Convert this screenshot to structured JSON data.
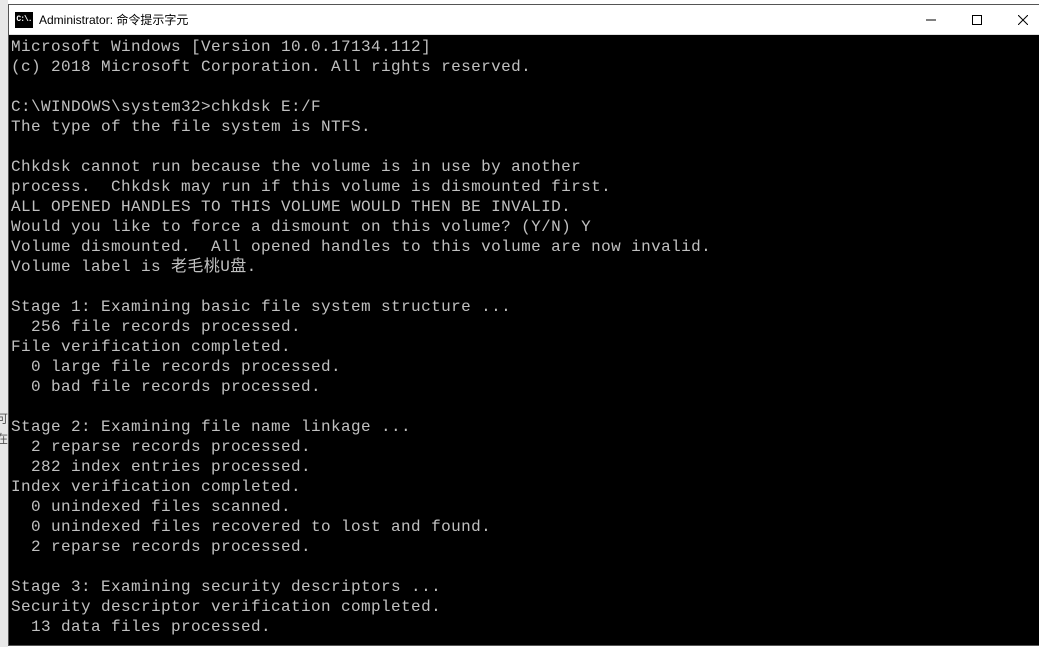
{
  "window": {
    "title": "Administrator: 命令提示字元",
    "icon_label": "C:\\."
  },
  "terminal_lines": [
    "Microsoft Windows [Version 10.0.17134.112]",
    "(c) 2018 Microsoft Corporation. All rights reserved.",
    "",
    "C:\\WINDOWS\\system32>chkdsk E:/F",
    "The type of the file system is NTFS.",
    "",
    "Chkdsk cannot run because the volume is in use by another",
    "process.  Chkdsk may run if this volume is dismounted first.",
    "ALL OPENED HANDLES TO THIS VOLUME WOULD THEN BE INVALID.",
    "Would you like to force a dismount on this volume? (Y/N) Y",
    "Volume dismounted.  All opened handles to this volume are now invalid.",
    "Volume label is 老毛桃U盘.",
    "",
    "Stage 1: Examining basic file system structure ...",
    "  256 file records processed.",
    "File verification completed.",
    "  0 large file records processed.",
    "  0 bad file records processed.",
    "",
    "Stage 2: Examining file name linkage ...",
    "  2 reparse records processed.",
    "  282 index entries processed.",
    "Index verification completed.",
    "  0 unindexed files scanned.",
    "  0 unindexed files recovered to lost and found.",
    "  2 reparse records processed.",
    "",
    "Stage 3: Examining security descriptors ...",
    "Security descriptor verification completed.",
    "  13 data files processed."
  ]
}
